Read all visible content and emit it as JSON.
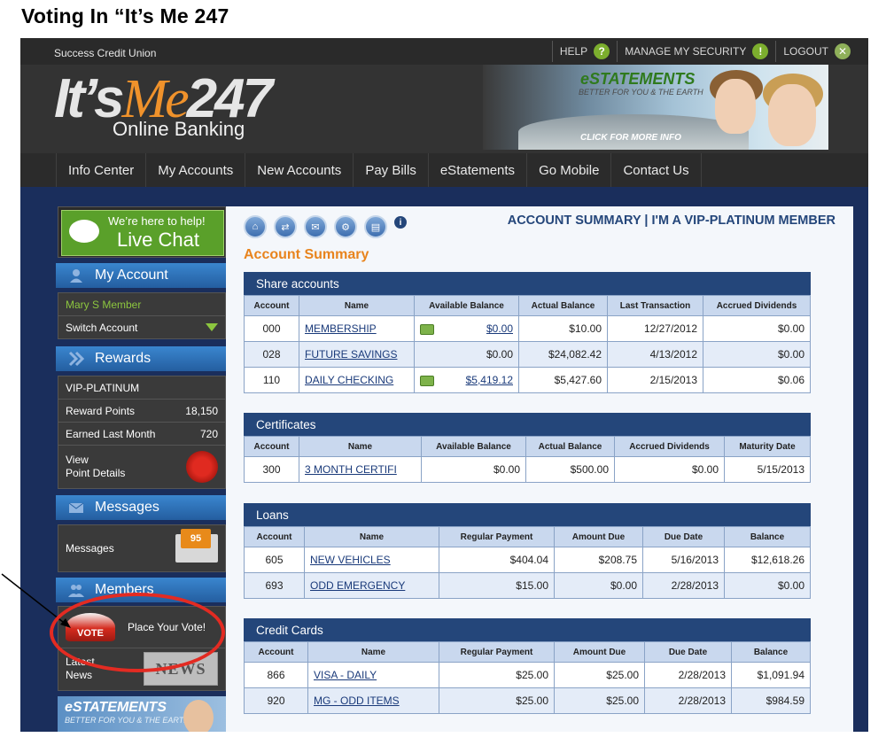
{
  "page_title": "Voting In “It’s Me 247",
  "topbar": {
    "cu_name": "Success Credit Union",
    "links": [
      "HELP",
      "MANAGE MY SECURITY",
      "LOGOUT"
    ]
  },
  "logo": {
    "main": "It’s",
    "me": "Me",
    "num": "247",
    "sub": "Online Banking"
  },
  "banner": {
    "title": "eSTATEMENTS",
    "subtitle": "BETTER FOR YOU & THE EARTH",
    "cta": "CLICK FOR MORE INFO"
  },
  "nav": [
    "Info Center",
    "My Accounts",
    "New Accounts",
    "Pay Bills",
    "eStatements",
    "Go Mobile",
    "Contact Us"
  ],
  "sidebar": {
    "chat": {
      "line1": "We’re here to help!",
      "line2": "Live Chat"
    },
    "my_account": {
      "title": "My Account",
      "member": "Mary S Member",
      "switch": "Switch Account"
    },
    "rewards": {
      "title": "Rewards",
      "tier": "VIP-PLATINUM",
      "points_label": "Reward Points",
      "points": "18,150",
      "earned_label": "Earned Last Month",
      "earned": "720",
      "view1": "View",
      "view2": "Point Details"
    },
    "messages": {
      "title": "Messages",
      "label": "Messages",
      "count": "95"
    },
    "members": {
      "title": "Members",
      "vote_hat": "VOTE",
      "vote": "Place Your Vote!",
      "news1": "Latest",
      "news2": "News",
      "news_icon": "NEWS"
    },
    "estatements": {
      "title": "eSTATEMENTS",
      "sub": "BETTER FOR YOU & THE EARTH"
    }
  },
  "main": {
    "header": "ACCOUNT SUMMARY | I'M A VIP-PLATINUM MEMBER",
    "title": "Account Summary",
    "share": {
      "title": "Share accounts",
      "columns": [
        "Account",
        "Name",
        "Available Balance",
        "Actual Balance",
        "Last Transaction",
        "Accrued Dividends"
      ],
      "rows": [
        [
          "000",
          "MEMBERSHIP",
          "$0.00",
          "$10.00",
          "12/27/2012",
          "$0.00"
        ],
        [
          "028",
          "FUTURE SAVINGS",
          "$0.00",
          "$24,082.42",
          "4/13/2012",
          "$0.00"
        ],
        [
          "110",
          "DAILY CHECKING",
          "$5,419.12",
          "$5,427.60",
          "2/15/2013",
          "$0.06"
        ]
      ]
    },
    "certificates": {
      "title": "Certificates",
      "columns": [
        "Account",
        "Name",
        "Available Balance",
        "Actual Balance",
        "Accrued Dividends",
        "Maturity Date"
      ],
      "rows": [
        [
          "300",
          "3 MONTH CERTIFI",
          "$0.00",
          "$500.00",
          "$0.00",
          "5/15/2013"
        ]
      ]
    },
    "loans": {
      "title": "Loans",
      "columns": [
        "Account",
        "Name",
        "Regular Payment",
        "Amount Due",
        "Due Date",
        "Balance"
      ],
      "rows": [
        [
          "605",
          "NEW VEHICLES",
          "$404.04",
          "$208.75",
          "5/16/2013",
          "$12,618.26"
        ],
        [
          "693",
          "ODD EMERGENCY",
          "$15.00",
          "$0.00",
          "2/28/2013",
          "$0.00"
        ]
      ]
    },
    "credit": {
      "title": "Credit Cards",
      "columns": [
        "Account",
        "Name",
        "Regular Payment",
        "Amount Due",
        "Due Date",
        "Balance"
      ],
      "rows": [
        [
          "866",
          "VISA - DAILY",
          "$25.00",
          "$25.00",
          "2/28/2013",
          "$1,091.94"
        ],
        [
          "920",
          "MG - ODD ITEMS",
          "$25.00",
          "$25.00",
          "2/28/2013",
          "$984.59"
        ]
      ]
    }
  },
  "colors": {
    "annotation": "#e32b22",
    "nav_dark": "#2b2b2b",
    "accent_blue": "#24467a",
    "accent_orange": "#e8841d"
  }
}
